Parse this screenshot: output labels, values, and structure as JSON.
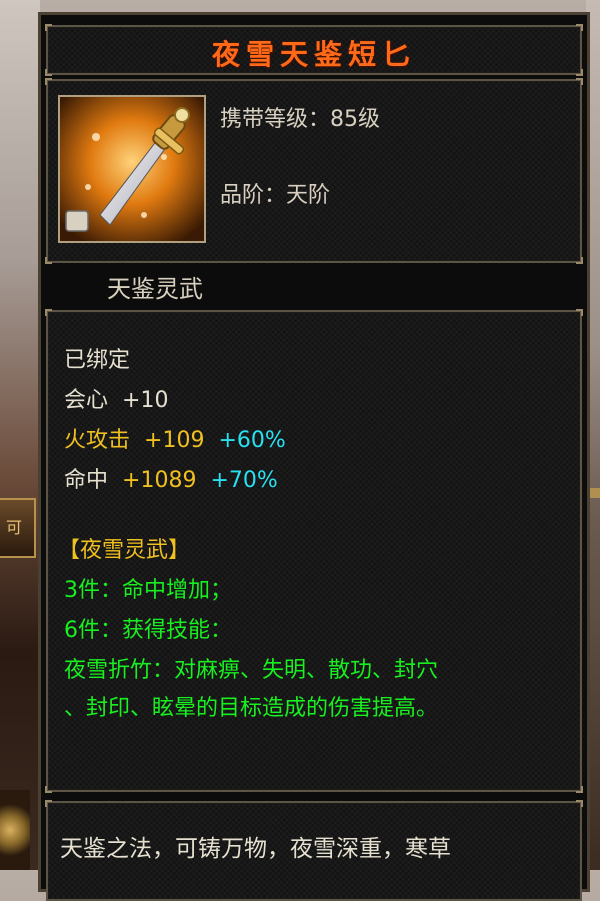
{
  "item": {
    "name": "夜雪天鉴短匕",
    "carry_level": "携带等级：85级",
    "grade": "品阶：天阶",
    "category": "天鉴灵武",
    "icon": "dagger-icon"
  },
  "stats": {
    "bound": "已绑定",
    "crit_label": "会心",
    "crit_value": "+10",
    "fire_label": "火攻击",
    "fire_value": "+109",
    "fire_percent": "+60%",
    "hit_label": "命中",
    "hit_value": "+1089",
    "hit_percent": "+70%"
  },
  "set": {
    "title": "【夜雪灵武】",
    "bonus_3": "3件：命中增加；",
    "bonus_6": "6件：获得技能：",
    "skill_line1": "夜雪折竹：对麻痹、失明、散功、封穴",
    "skill_line2": "、封印、眩晕的目标造成的伤害提高。"
  },
  "description": {
    "line1": "天鉴之法，可铸万物，夜雪深重，寒草"
  },
  "colors": {
    "title": "#ff6a1a",
    "white_text": "#e6e0d0",
    "yellow_text": "#f0c020",
    "cyan_text": "#28e0f0",
    "green_text": "#18f020"
  }
}
